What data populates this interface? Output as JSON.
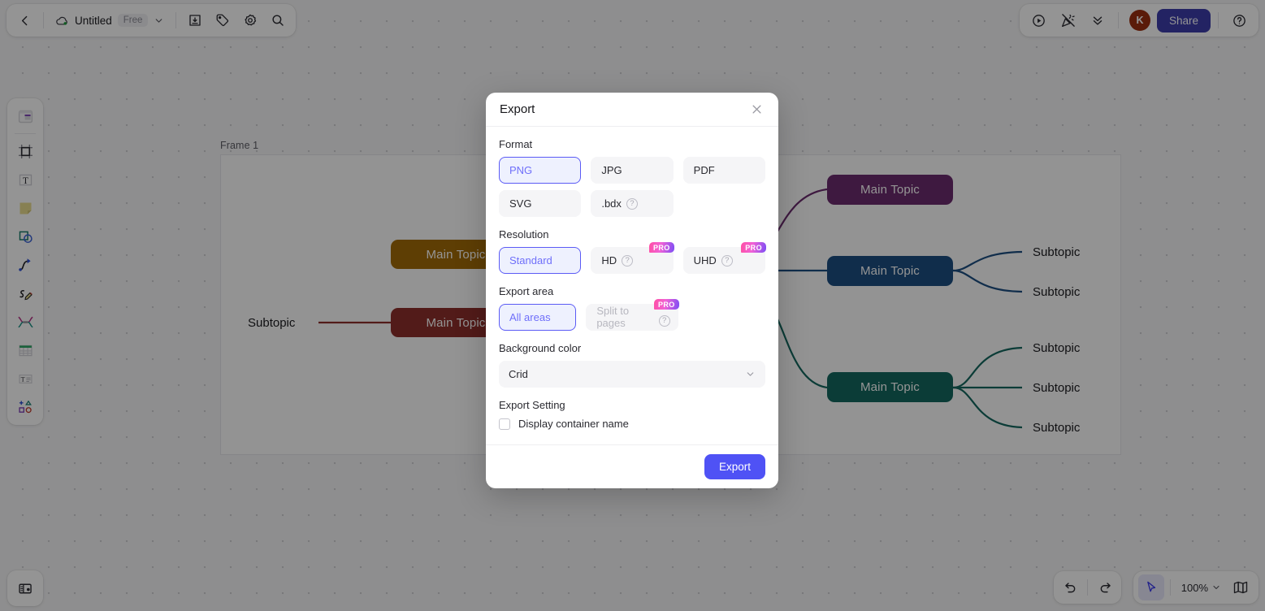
{
  "topbar": {
    "back_icon": "chevron-left-icon",
    "cloud_icon": "cloud-saved-icon",
    "doc_title": "Untitled",
    "plan_badge": "Free",
    "dropdown_icon": "chevron-down-icon",
    "download_icon": "download-icon",
    "tag_icon": "tag-icon",
    "settings_icon": "gear-icon",
    "search_icon": "search-icon",
    "present_icon": "play-circle-icon",
    "celebrate_icon": "party-popper-muted-icon",
    "collapse_icon": "double-chevron-down-icon",
    "avatar_initial": "K",
    "share_label": "Share",
    "help_icon": "help-circle-icon"
  },
  "left_toolbar": {
    "items": [
      {
        "name": "template-icon"
      },
      {
        "name": "frame-icon"
      },
      {
        "name": "text-box-icon"
      },
      {
        "name": "sticky-note-icon"
      },
      {
        "name": "shapes-icon"
      },
      {
        "name": "connector-curve-icon"
      },
      {
        "name": "pencil-draw-icon"
      },
      {
        "name": "mindmap-icon"
      },
      {
        "name": "table-icon"
      },
      {
        "name": "text-style-icon"
      },
      {
        "name": "more-shapes-icon"
      }
    ],
    "bottom_icon": "notes-panel-icon"
  },
  "bottom_bar": {
    "undo_icon": "undo-icon",
    "redo_icon": "redo-icon",
    "cursor_icon": "cursor-select-icon",
    "zoom_level": "100%",
    "zoom_caret_icon": "chevron-down-icon",
    "minimap_icon": "minimap-icon"
  },
  "canvas": {
    "frame_label": "Frame 1",
    "nodes": [
      {
        "label": "Main Topic",
        "color": "#a36b07"
      },
      {
        "label": "Main Topic",
        "color": "#8e2f2b"
      },
      {
        "label": "Main Topic",
        "color": "#6b2c6e"
      },
      {
        "label": "Main Topic",
        "color": "#1d4f82"
      },
      {
        "label": "Main Topic",
        "color": "#14685f"
      }
    ],
    "subtopics": [
      {
        "label": "Subtopic"
      },
      {
        "label": "Subtopic"
      },
      {
        "label": "Subtopic"
      },
      {
        "label": "Subtopic"
      },
      {
        "label": "Subtopic"
      },
      {
        "label": "Subtopic"
      }
    ]
  },
  "modal": {
    "title": "Export",
    "close_icon": "close-icon",
    "format": {
      "label": "Format",
      "options": [
        {
          "label": "PNG",
          "selected": true,
          "pro": false,
          "help": false
        },
        {
          "label": "JPG",
          "selected": false,
          "pro": false,
          "help": false
        },
        {
          "label": "PDF",
          "selected": false,
          "pro": false,
          "help": false
        },
        {
          "label": "SVG",
          "selected": false,
          "pro": false,
          "help": false
        },
        {
          "label": ".bdx",
          "selected": false,
          "pro": false,
          "help": true
        }
      ]
    },
    "resolution": {
      "label": "Resolution",
      "options": [
        {
          "label": "Standard",
          "selected": true,
          "pro": false,
          "help": false
        },
        {
          "label": "HD",
          "selected": false,
          "pro": true,
          "help": true
        },
        {
          "label": "UHD",
          "selected": false,
          "pro": true,
          "help": true
        }
      ],
      "pro_badge": "PRO"
    },
    "export_area": {
      "label": "Export area",
      "options": [
        {
          "label": "All areas",
          "selected": true,
          "pro": false,
          "help": false
        },
        {
          "label": "Split to pages",
          "selected": false,
          "pro": true,
          "help": true,
          "disabled": true
        }
      ],
      "pro_badge": "PRO"
    },
    "background_color": {
      "label": "Background color",
      "value": "Crid",
      "caret_icon": "chevron-down-icon"
    },
    "export_setting": {
      "label": "Export Setting",
      "checkbox_label": "Display container name",
      "checked": false
    },
    "submit_label": "Export",
    "accent_color": "#4f52f5",
    "selected_border": "#5b5bf5",
    "selected_bg": "#eef1fe"
  }
}
